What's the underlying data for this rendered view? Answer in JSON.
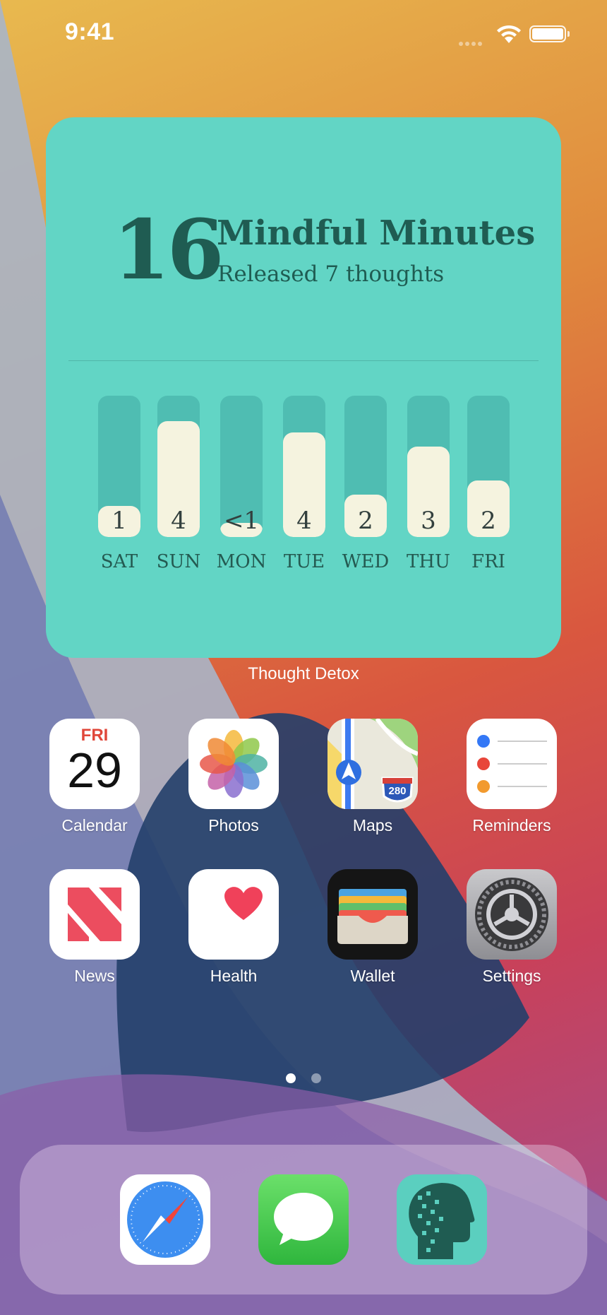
{
  "status_bar": {
    "time": "9:41"
  },
  "widget": {
    "count": "16",
    "title": "Mindful Minutes",
    "subtitle": "Released 7 thoughts",
    "label": "Thought Detox",
    "chart_data": {
      "type": "bar",
      "categories": [
        "SAT",
        "SUN",
        "MON",
        "TUE",
        "WED",
        "THU",
        "FRI"
      ],
      "value_labels": [
        "1",
        "4",
        "<1",
        "4",
        "2",
        "3",
        "2"
      ],
      "fill_fraction": [
        0.22,
        0.82,
        0.1,
        0.74,
        0.3,
        0.64,
        0.4
      ]
    }
  },
  "apps": [
    {
      "label": "Calendar",
      "icon": "calendar-icon",
      "day": "FRI",
      "date": "29"
    },
    {
      "label": "Photos",
      "icon": "photos-icon"
    },
    {
      "label": "Maps",
      "icon": "maps-icon",
      "route": "280"
    },
    {
      "label": "Reminders",
      "icon": "reminders-icon"
    },
    {
      "label": "News",
      "icon": "news-icon"
    },
    {
      "label": "Health",
      "icon": "health-icon"
    },
    {
      "label": "Wallet",
      "icon": "wallet-icon"
    },
    {
      "label": "Settings",
      "icon": "settings-icon"
    }
  ],
  "page_dots": {
    "count": 2,
    "active": 0
  },
  "dock": [
    {
      "icon": "safari-icon"
    },
    {
      "icon": "messages-icon"
    },
    {
      "icon": "thought-detox-icon"
    }
  ]
}
